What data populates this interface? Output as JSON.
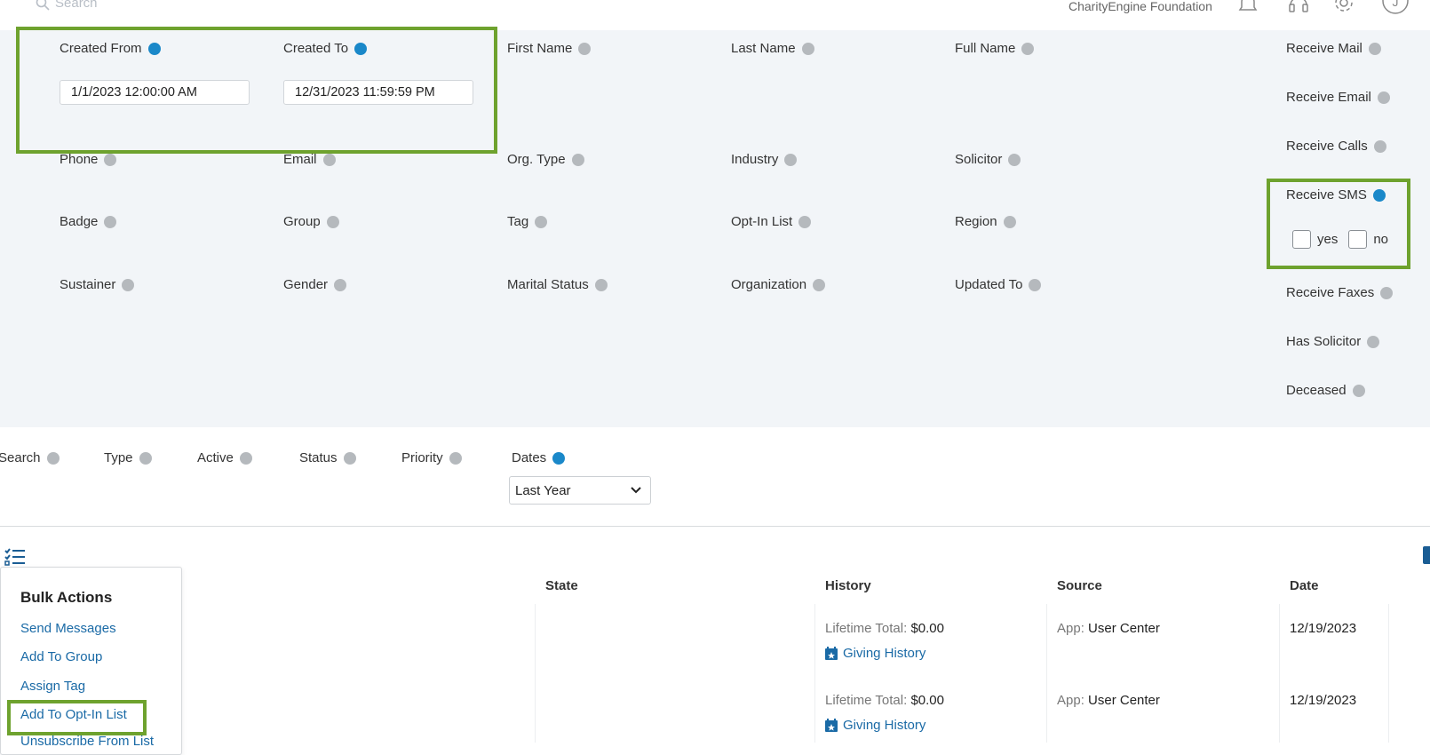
{
  "topbar": {
    "search_placeholder": "Search",
    "org_name": "CharityEngine Foundation",
    "icons": [
      "bell-icon",
      "headset-icon",
      "gear-icon",
      "user-avatar-icon"
    ],
    "avatar_letter": "J"
  },
  "filters": {
    "created_from": {
      "label": "Created From",
      "value": "1/1/2023 12:00:00 AM"
    },
    "created_to": {
      "label": "Created To",
      "value": "12/31/2023 11:59:59 PM"
    },
    "first_name": "First Name",
    "last_name": "Last Name",
    "full_name": "Full Name",
    "phone": "Phone",
    "email": "Email",
    "org_type": "Org. Type",
    "industry": "Industry",
    "solicitor": "Solicitor",
    "badge": "Badge",
    "group": "Group",
    "tag": "Tag",
    "opt_in_list": "Opt-In List",
    "region": "Region",
    "sustainer": "Sustainer",
    "gender": "Gender",
    "marital_status": "Marital Status",
    "organization": "Organization",
    "updated_to": "Updated To",
    "receive_mail": "Receive Mail",
    "receive_email": "Receive Email",
    "receive_calls": "Receive Calls",
    "receive_sms": {
      "label": "Receive SMS",
      "yes": "yes",
      "no": "no"
    },
    "receive_faxes": "Receive Faxes",
    "has_solicitor": "Has Solicitor",
    "deceased": "Deceased"
  },
  "secondary_filters": {
    "search": "Search",
    "type": "Type",
    "active": "Active",
    "status": "Status",
    "priority": "Priority",
    "dates": {
      "label": "Dates",
      "selected": "Last Year"
    }
  },
  "table": {
    "headers": {
      "state": "State",
      "history": "History",
      "source": "Source",
      "date": "Date"
    },
    "rows": [
      {
        "lifetime_label": "Lifetime Total:",
        "lifetime_value": "$0.00",
        "giving_link": "Giving History",
        "source_label": "App:",
        "source_value": "User Center",
        "date": "12/19/2023"
      },
      {
        "lifetime_label": "Lifetime Total:",
        "lifetime_value": "$0.00",
        "giving_link": "Giving History",
        "source_label": "App:",
        "source_value": "User Center",
        "date": "12/19/2023"
      }
    ]
  },
  "bulk_actions": {
    "title": "Bulk Actions",
    "items": [
      "Send Messages",
      "Add To Group",
      "Assign Tag",
      "Add To Opt-In List",
      "Unsubscribe From List"
    ]
  },
  "colors": {
    "highlight": "#6ea22e",
    "active_dot": "#1a88c9",
    "inactive_dot": "#b5b9bd",
    "link": "#1a6aa6"
  }
}
